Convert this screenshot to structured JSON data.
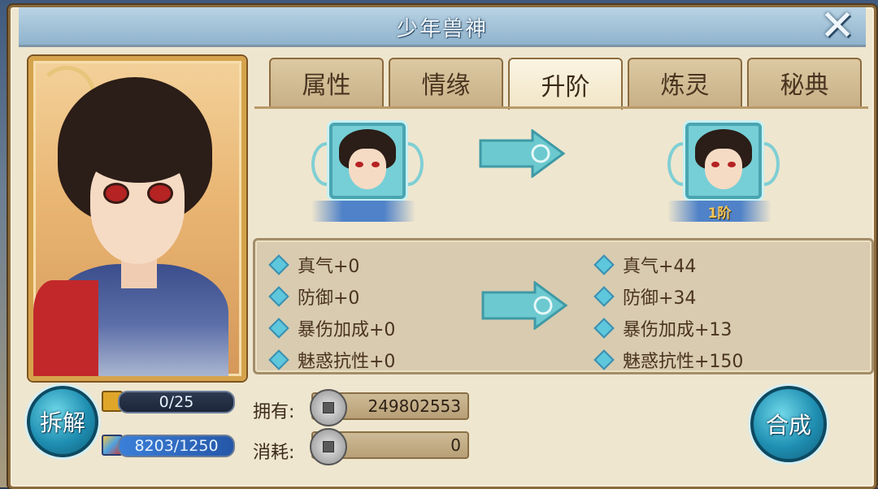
{
  "window": {
    "title": "少年兽神"
  },
  "tabs": [
    {
      "label": "属性"
    },
    {
      "label": "情缘"
    },
    {
      "label": "升阶"
    },
    {
      "label": "炼灵"
    },
    {
      "label": "秘典"
    }
  ],
  "active_tab": "升阶",
  "upgrade": {
    "current_rank_label": "",
    "next_rank_label": "1阶"
  },
  "stats": {
    "current": [
      {
        "text": "真气+0"
      },
      {
        "text": "防御+0"
      },
      {
        "text": "暴伤加成+0"
      },
      {
        "text": "魅惑抗性+0"
      }
    ],
    "next": [
      {
        "text": "真气+44"
      },
      {
        "text": "防御+34"
      },
      {
        "text": "暴伤加成+13"
      },
      {
        "text": "魅惑抗性+150"
      }
    ]
  },
  "resources": {
    "fragments": "0/25",
    "exp": "8203/1250"
  },
  "currency": {
    "owned_label": "拥有:",
    "owned_value": "249802553",
    "cost_label": "消耗:",
    "cost_value": "0"
  },
  "buttons": {
    "dismantle": "拆解",
    "combine": "合成"
  },
  "colors": {
    "accent": "#1f8fb2",
    "title_bar": "#8fb3cc",
    "panel": "#efe6cf"
  }
}
